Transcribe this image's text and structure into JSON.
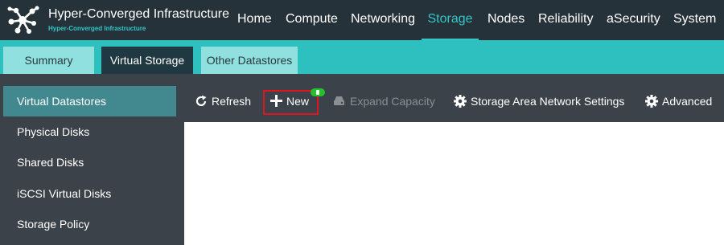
{
  "app": {
    "title": "Hyper-Converged Infrastructure",
    "subtitle": "Hyper-Converged Infrastructure",
    "logo_icon": "network-nodes-logo"
  },
  "nav": {
    "items": [
      {
        "label": "Home",
        "active": false
      },
      {
        "label": "Compute",
        "active": false
      },
      {
        "label": "Networking",
        "active": false
      },
      {
        "label": "Storage",
        "active": true
      },
      {
        "label": "Nodes",
        "active": false
      },
      {
        "label": "Reliability",
        "active": false
      },
      {
        "label": "aSecurity",
        "active": false
      },
      {
        "label": "System",
        "active": false
      }
    ]
  },
  "tabs": [
    {
      "label": "Summary",
      "active": false
    },
    {
      "label": "Virtual Storage",
      "active": true
    },
    {
      "label": "Other Datastores",
      "active": false
    }
  ],
  "sidebar": {
    "items": [
      {
        "label": "Virtual Datastores",
        "active": true
      },
      {
        "label": "Physical Disks",
        "active": false
      },
      {
        "label": "Shared Disks",
        "active": false
      },
      {
        "label": "iSCSI Virtual Disks",
        "active": false
      },
      {
        "label": "Storage Policy",
        "active": false
      }
    ]
  },
  "toolbar": {
    "refresh": {
      "label": "Refresh",
      "icon": "refresh-icon"
    },
    "new": {
      "label": "New",
      "icon": "plus-icon",
      "highlighted": true
    },
    "expand": {
      "label": "Expand Capacity",
      "icon": "database-expand-icon",
      "disabled": true
    },
    "san": {
      "label": "Storage Area Network Settings",
      "icon": "gear-icon"
    },
    "advanced": {
      "label": "Advanced",
      "icon": "gear-icon"
    }
  },
  "colors": {
    "topbar": "#263239",
    "accent": "#33c7c7",
    "tab_strip": "#2ebfbf",
    "tab_active": "#1f3842",
    "tab_inactive": "#8fe0df",
    "panel": "#3b4249",
    "sidebar_active": "#42888f",
    "highlight": "#e0141e",
    "badge": "#22c22e"
  }
}
